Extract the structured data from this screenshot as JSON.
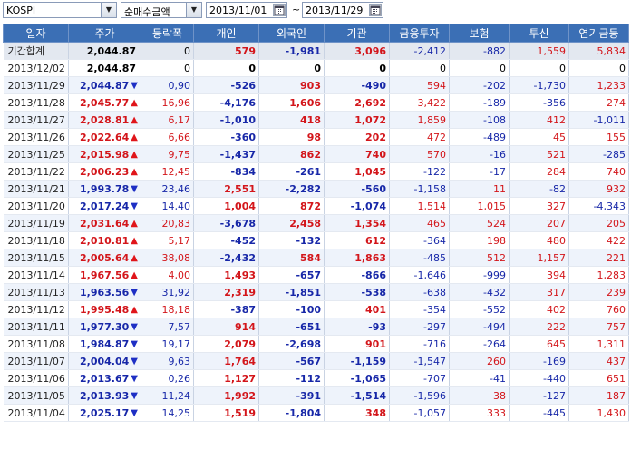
{
  "toolbar": {
    "market": "KOSPI",
    "metric": "순매수금액",
    "date_from": "2013/11/01",
    "separator": "~",
    "date_to": "2013/11/29"
  },
  "columns": [
    "일자",
    "주가",
    "등락폭",
    "개인",
    "외국인",
    "기관",
    "금융투자",
    "보험",
    "투신",
    "연기금등"
  ],
  "colors": {
    "header_bg": "#3b6fb5",
    "positive": "#d3151a",
    "negative": "#1727a8",
    "up_arrow": "#e0151a",
    "down_arrow": "#1e2fc4"
  },
  "rows": [
    {
      "date": "기간합계",
      "price": "2,044.87",
      "dir": "",
      "change": "0",
      "individual": "579",
      "foreign": "-1,981",
      "institution": "3,096",
      "fin_invest": "-2,412",
      "insurance": "-882",
      "trust": "1,559",
      "pension": "5,834",
      "sum": true
    },
    {
      "date": "2013/12/02",
      "price": "2,044.87",
      "dir": "",
      "change": "0",
      "individual": "0",
      "foreign": "0",
      "institution": "0",
      "fin_invest": "0",
      "insurance": "0",
      "trust": "0",
      "pension": "0"
    },
    {
      "date": "2013/11/29",
      "price": "2,044.87",
      "dir": "down",
      "change": "0,90",
      "individual": "-526",
      "foreign": "903",
      "institution": "-490",
      "fin_invest": "594",
      "insurance": "-202",
      "trust": "-1,730",
      "pension": "1,233"
    },
    {
      "date": "2013/11/28",
      "price": "2,045.77",
      "dir": "up",
      "change": "16,96",
      "individual": "-4,176",
      "foreign": "1,606",
      "institution": "2,692",
      "fin_invest": "3,422",
      "insurance": "-189",
      "trust": "-356",
      "pension": "274"
    },
    {
      "date": "2013/11/27",
      "price": "2,028.81",
      "dir": "up",
      "change": "6,17",
      "individual": "-1,010",
      "foreign": "418",
      "institution": "1,072",
      "fin_invest": "1,859",
      "insurance": "-108",
      "trust": "412",
      "pension": "-1,011"
    },
    {
      "date": "2013/11/26",
      "price": "2,022.64",
      "dir": "up",
      "change": "6,66",
      "individual": "-360",
      "foreign": "98",
      "institution": "202",
      "fin_invest": "472",
      "insurance": "-489",
      "trust": "45",
      "pension": "155"
    },
    {
      "date": "2013/11/25",
      "price": "2,015.98",
      "dir": "up",
      "change": "9,75",
      "individual": "-1,437",
      "foreign": "862",
      "institution": "740",
      "fin_invest": "570",
      "insurance": "-16",
      "trust": "521",
      "pension": "-285"
    },
    {
      "date": "2013/11/22",
      "price": "2,006.23",
      "dir": "up",
      "change": "12,45",
      "individual": "-834",
      "foreign": "-261",
      "institution": "1,045",
      "fin_invest": "-122",
      "insurance": "-17",
      "trust": "284",
      "pension": "740"
    },
    {
      "date": "2013/11/21",
      "price": "1,993.78",
      "dir": "down",
      "change": "23,46",
      "individual": "2,551",
      "foreign": "-2,282",
      "institution": "-560",
      "fin_invest": "-1,158",
      "insurance": "11",
      "trust": "-82",
      "pension": "932"
    },
    {
      "date": "2013/11/20",
      "price": "2,017.24",
      "dir": "down",
      "change": "14,40",
      "individual": "1,004",
      "foreign": "872",
      "institution": "-1,074",
      "fin_invest": "1,514",
      "insurance": "1,015",
      "trust": "327",
      "pension": "-4,343"
    },
    {
      "date": "2013/11/19",
      "price": "2,031.64",
      "dir": "up",
      "change": "20,83",
      "individual": "-3,678",
      "foreign": "2,458",
      "institution": "1,354",
      "fin_invest": "465",
      "insurance": "524",
      "trust": "207",
      "pension": "205"
    },
    {
      "date": "2013/11/18",
      "price": "2,010.81",
      "dir": "up",
      "change": "5,17",
      "individual": "-452",
      "foreign": "-132",
      "institution": "612",
      "fin_invest": "-364",
      "insurance": "198",
      "trust": "480",
      "pension": "422"
    },
    {
      "date": "2013/11/15",
      "price": "2,005.64",
      "dir": "up",
      "change": "38,08",
      "individual": "-2,432",
      "foreign": "584",
      "institution": "1,863",
      "fin_invest": "-485",
      "insurance": "512",
      "trust": "1,157",
      "pension": "221"
    },
    {
      "date": "2013/11/14",
      "price": "1,967.56",
      "dir": "up",
      "change": "4,00",
      "individual": "1,493",
      "foreign": "-657",
      "institution": "-866",
      "fin_invest": "-1,646",
      "insurance": "-999",
      "trust": "394",
      "pension": "1,283"
    },
    {
      "date": "2013/11/13",
      "price": "1,963.56",
      "dir": "down",
      "change": "31,92",
      "individual": "2,319",
      "foreign": "-1,851",
      "institution": "-538",
      "fin_invest": "-638",
      "insurance": "-432",
      "trust": "317",
      "pension": "239"
    },
    {
      "date": "2013/11/12",
      "price": "1,995.48",
      "dir": "up",
      "change": "18,18",
      "individual": "-387",
      "foreign": "-100",
      "institution": "401",
      "fin_invest": "-354",
      "insurance": "-552",
      "trust": "402",
      "pension": "760"
    },
    {
      "date": "2013/11/11",
      "price": "1,977.30",
      "dir": "down",
      "change": "7,57",
      "individual": "914",
      "foreign": "-651",
      "institution": "-93",
      "fin_invest": "-297",
      "insurance": "-494",
      "trust": "222",
      "pension": "757"
    },
    {
      "date": "2013/11/08",
      "price": "1,984.87",
      "dir": "down",
      "change": "19,17",
      "individual": "2,079",
      "foreign": "-2,698",
      "institution": "901",
      "fin_invest": "-716",
      "insurance": "-264",
      "trust": "645",
      "pension": "1,311"
    },
    {
      "date": "2013/11/07",
      "price": "2,004.04",
      "dir": "down",
      "change": "9,63",
      "individual": "1,764",
      "foreign": "-567",
      "institution": "-1,159",
      "fin_invest": "-1,547",
      "insurance": "260",
      "trust": "-169",
      "pension": "437"
    },
    {
      "date": "2013/11/06",
      "price": "2,013.67",
      "dir": "down",
      "change": "0,26",
      "individual": "1,127",
      "foreign": "-112",
      "institution": "-1,065",
      "fin_invest": "-707",
      "insurance": "-41",
      "trust": "-440",
      "pension": "651"
    },
    {
      "date": "2013/11/05",
      "price": "2,013.93",
      "dir": "down",
      "change": "11,24",
      "individual": "1,992",
      "foreign": "-391",
      "institution": "-1,514",
      "fin_invest": "-1,596",
      "insurance": "38",
      "trust": "-127",
      "pension": "187"
    },
    {
      "date": "2013/11/04",
      "price": "2,025.17",
      "dir": "down",
      "change": "14,25",
      "individual": "1,519",
      "foreign": "-1,804",
      "institution": "348",
      "fin_invest": "-1,057",
      "insurance": "333",
      "trust": "-445",
      "pension": "1,430"
    }
  ]
}
